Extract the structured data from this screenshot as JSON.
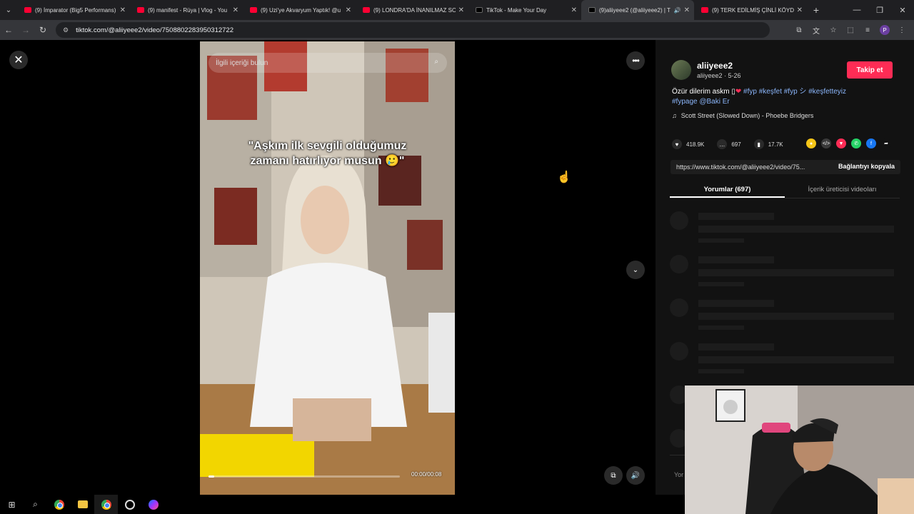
{
  "browser": {
    "tabs": [
      {
        "title": "(9) İmparator (Big5 Performans)",
        "favicon": "youtube-icon",
        "active": false
      },
      {
        "title": "(9) manifest - Rüya | Vlog - You",
        "favicon": "youtube-icon",
        "active": false
      },
      {
        "title": "(9) Uzi'ye Akvaryum Yaptık! @u",
        "favicon": "youtube-icon",
        "active": false
      },
      {
        "title": "(9) LONDRA'DA İNANILMAZ SO",
        "favicon": "youtube-icon",
        "active": false
      },
      {
        "title": "TikTok - Make Your Day",
        "favicon": "tiktok-icon",
        "active": false
      },
      {
        "title": "(9)aliiyeee2 (@aliiyeee2) | T",
        "favicon": "tiktok-icon",
        "active": true
      },
      {
        "title": "(9) TERK EDİLMİŞ ÇİNLİ KÖYDE",
        "favicon": "youtube-icon",
        "active": false
      }
    ],
    "url": "tiktok.com/@aliiyeee2/video/7508802283950312722"
  },
  "video": {
    "search_placeholder": "İlgili içeriği bulun",
    "caption_line1": "\"Aşkım ilk sevgili olduğumuz",
    "caption_line2": "zamanı hatırlıyor musun 🥲\"",
    "timecode": "00:00/00:08",
    "progress": 0.03
  },
  "author": {
    "username": "aliiyeee2",
    "subline": "aliiyeee2 · 5-26",
    "follow_label": "Takip et"
  },
  "post": {
    "text": "Özür dilerim askm",
    "heart": "❤",
    "tags_line1": "#fyp #keşfet #fyp シ #keşfetteyiz",
    "tags_line2": "#fypage @Baki Er",
    "music": "Scott Street (Slowed Down) - Phoebe Bridgers"
  },
  "stats": {
    "likes": "418.9K",
    "comments": "697",
    "saves": "17.7K"
  },
  "share": {
    "link": "https://www.tiktok.com/@aliiyeee2/video/75...",
    "copy_label": "Bağlantıyı kopyala",
    "icons": [
      {
        "name": "embed-coin-icon",
        "color": "#f5c518"
      },
      {
        "name": "embed-code-icon",
        "color": "#3a3a3a"
      },
      {
        "name": "send-icon",
        "color": "#fe2c55"
      },
      {
        "name": "whatsapp-icon",
        "color": "#25d366"
      },
      {
        "name": "facebook-icon",
        "color": "#1877f2"
      },
      {
        "name": "share-arrow-icon",
        "color": "#121212"
      }
    ]
  },
  "panel_tabs": {
    "comments": "Yorumlar (697)",
    "creator_videos": "İçerik üreticisi videoları"
  },
  "comment_input_placeholder": "Yor",
  "colors": {
    "accent": "#fe2c55",
    "tag": "#8ab4f8",
    "background": "#000000"
  }
}
